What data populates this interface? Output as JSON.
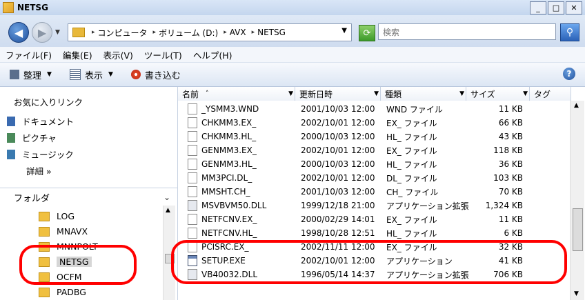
{
  "window": {
    "title": "NETSG",
    "minimize": "_",
    "maximize": "□",
    "close": "✕"
  },
  "address": {
    "crumbs": [
      "コンピュータ",
      "ボリューム (D:)",
      "AVX",
      "NETSG"
    ],
    "search_placeholder": "検索"
  },
  "menu": [
    "ファイル(F)",
    "編集(E)",
    "表示(V)",
    "ツール(T)",
    "ヘルプ(H)"
  ],
  "toolbar": {
    "organize": "整理",
    "views": "表示",
    "burn": "書き込む",
    "help": "?"
  },
  "favorites": {
    "title": "お気に入りリンク",
    "items": [
      "ドキュメント",
      "ピクチャ",
      "ミュージック"
    ],
    "more": "詳細 »"
  },
  "folders": {
    "header": "フォルダ",
    "items": [
      "LOG",
      "MNAVX",
      "MNNPOLT",
      "NETSG",
      "OCFM",
      "PADBG"
    ],
    "selected": "NETSG"
  },
  "columns": [
    "名前",
    "更新日時",
    "種類",
    "サイズ",
    "タグ"
  ],
  "files": [
    {
      "name": "_YSMM3.WND",
      "date": "2001/10/03 12:00",
      "type": "WND ファイル",
      "size": "11 KB"
    },
    {
      "name": "CHKMM3.EX_",
      "date": "2002/10/01 12:00",
      "type": "EX_ ファイル",
      "size": "66 KB"
    },
    {
      "name": "CHKMM3.HL_",
      "date": "2000/10/03 12:00",
      "type": "HL_ ファイル",
      "size": "43 KB"
    },
    {
      "name": "GENMM3.EX_",
      "date": "2002/10/01 12:00",
      "type": "EX_ ファイル",
      "size": "118 KB"
    },
    {
      "name": "GENMM3.HL_",
      "date": "2000/10/03 12:00",
      "type": "HL_ ファイル",
      "size": "36 KB"
    },
    {
      "name": "MM3PCI.DL_",
      "date": "2002/10/01 12:00",
      "type": "DL_ ファイル",
      "size": "103 KB"
    },
    {
      "name": "MMSHT.CH_",
      "date": "2001/10/03 12:00",
      "type": "CH_ ファイル",
      "size": "70 KB"
    },
    {
      "name": "MSVBVM50.DLL",
      "date": "1999/12/18 21:00",
      "type": "アプリケーション拡張",
      "size": "1,324 KB"
    },
    {
      "name": "NETFCNV.EX_",
      "date": "2000/02/29 14:01",
      "type": "EX_ ファイル",
      "size": "11 KB"
    },
    {
      "name": "NETFCNV.HL_",
      "date": "1998/10/28 12:51",
      "type": "HL_ ファイル",
      "size": "6 KB"
    },
    {
      "name": "PCISRC.EX_",
      "date": "2002/11/11 12:00",
      "type": "EX_ ファイル",
      "size": "32 KB"
    },
    {
      "name": "SETUP.EXE",
      "date": "2002/10/01 12:00",
      "type": "アプリケーション",
      "size": "41 KB"
    },
    {
      "name": "VB40032.DLL",
      "date": "1996/05/14 14:37",
      "type": "アプリケーション拡張",
      "size": "706 KB"
    }
  ],
  "colors": {
    "annotation": "#ff0000",
    "selection": "#d6d6d6"
  }
}
